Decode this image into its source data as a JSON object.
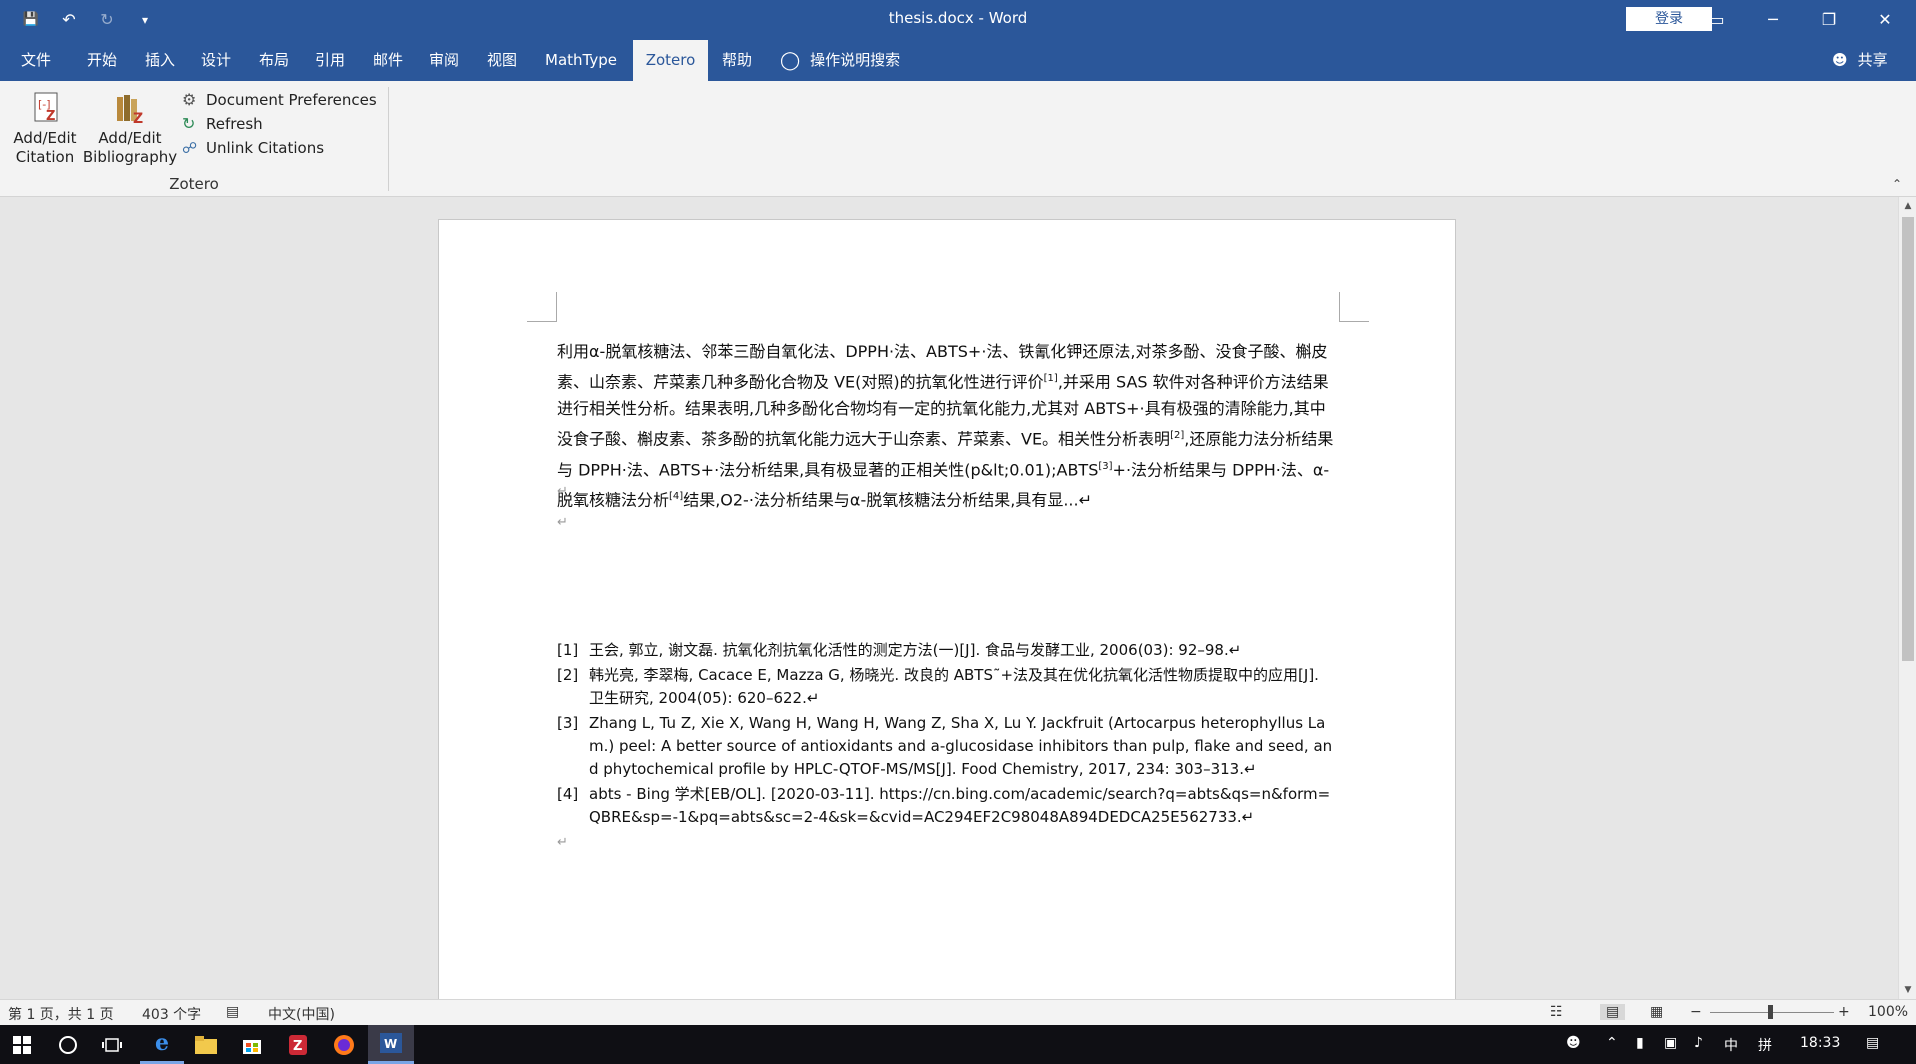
{
  "window": {
    "title": "thesis.docx  -  Word",
    "login_label": "登录",
    "controls": {
      "minimize": "─",
      "restore": "❐",
      "close": "✕",
      "ribbon_display": "▭"
    }
  },
  "qat": {
    "save": "💾",
    "undo": "↶",
    "redo": "↻",
    "customize": "▾"
  },
  "tabs": [
    "文件",
    "开始",
    "插入",
    "设计",
    "布局",
    "引用",
    "邮件",
    "审阅",
    "视图",
    "MathType",
    "Zotero",
    "帮助"
  ],
  "active_tab": "Zotero",
  "tell_me": "操作说明搜索",
  "share": "共享",
  "ribbon": {
    "add_citation_line1": "Add/Edit",
    "add_citation_line2": "Citation",
    "add_bib_line1": "Add/Edit",
    "add_bib_line2": "Bibliography",
    "doc_prefs": "Document Preferences",
    "refresh": "Refresh",
    "unlink": "Unlink Citations",
    "group_label": "Zotero"
  },
  "document": {
    "para1": [
      "利用α-脱氧核糖法、邻苯三酚自氧化法、DPPH·法、ABTS+·法、铁氰化钾还原法,对茶多酚、没食子酸、槲皮素、山奈素、芹菜素几种多酚化合物及 VE(对照)的抗氧化性进行评价",
      "[1]",
      ",并采用 SAS 软件对各种评价方法结果进行相关性分析。结果表明,几种多酚化合物均有一定的抗氧化能力,尤其对 ABTS+·具有极强的清除能力,其中没食子酸、槲皮素、茶多酚的抗氧化能力远大于山奈素、芹菜素、VE。相关性分析表明",
      "[2]",
      ",还原能力法分析结果与 DPPH·法、ABTS+·法分析结果,具有极显著的正相关性(p&lt;0.01);ABTS",
      "[3]",
      "+·法分析结果与 DPPH·法、α-脱氧核糖法分析",
      "[4]",
      "结果,O2-·法分析结果与α-脱氧核糖法分析结果,具有显...↵"
    ],
    "paragraph_mark": "↵",
    "bibliography": [
      {
        "num": "[1]",
        "text": "王会, 郭立, 谢文磊. 抗氧化剂抗氧化活性的测定方法(一)[J]. 食品与发酵工业, 2006(03): 92–98.↵"
      },
      {
        "num": "[2]",
        "text": "韩光亮, 李翠梅, Cacace E, Mazza G, 杨晓光. 改良的 ABTS˜+法及其在优化抗氧化活性物质提取中的应用[J]. 卫生研究, 2004(05): 620–622.↵"
      },
      {
        "num": "[3]",
        "text": "Zhang L, Tu Z, Xie X, Wang H, Wang H, Wang Z, Sha X, Lu Y. Jackfruit (Artocarpus heterophyllus Lam.) peel: A better source of antioxidants and a-glucosidase inhibitors than pulp, flake and seed, and phytochemical profile by HPLC-QTOF-MS/MS[J]. Food Chemistry, 2017, 234: 303–313.↵"
      },
      {
        "num": "[4]",
        "text": "abts - Bing 学术[EB/OL]. [2020-03-11]. https://cn.bing.com/academic/search?q=abts&qs=n&form=QBRE&sp=-1&pq=abts&sc=2-4&sk=&cvid=AC294EF2C98048A894DEDCA25E562733.↵"
      }
    ]
  },
  "status": {
    "page": "第 1 页，共 1 页",
    "words": "403 个字",
    "language": "中文(中国)",
    "zoom": "100%",
    "zoom_level_percent": 100
  },
  "taskbar": {
    "time": "18:33",
    "ime": "中",
    "ime_mode": "拼"
  }
}
